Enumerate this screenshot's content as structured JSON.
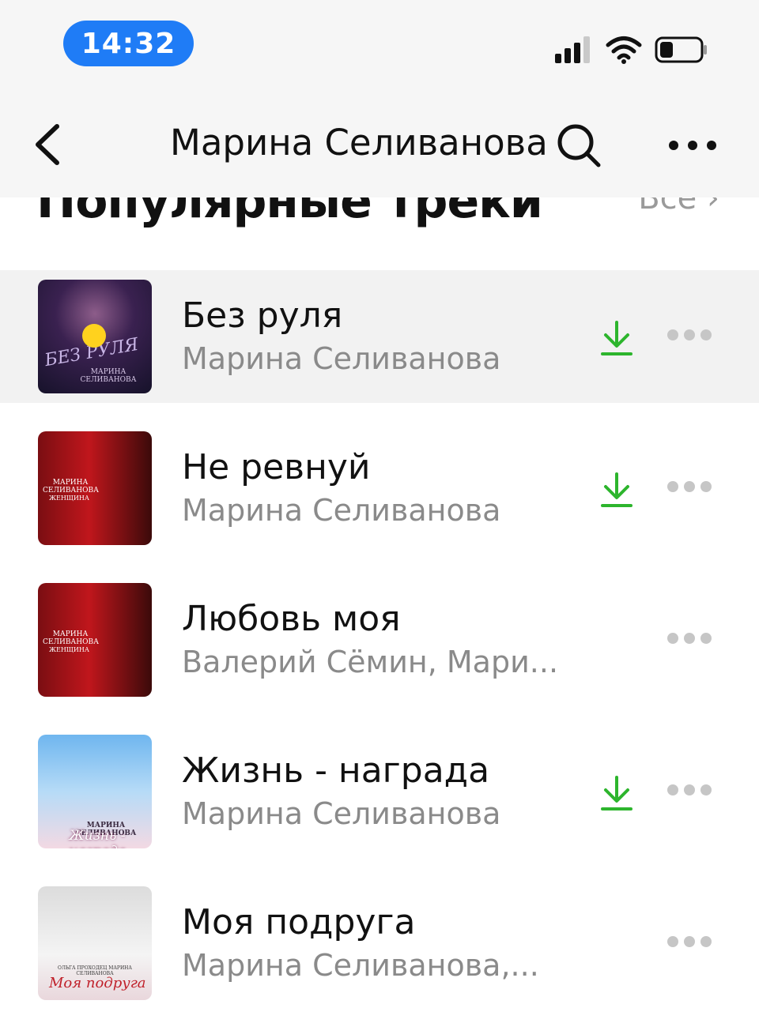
{
  "status_bar": {
    "time": "14:32"
  },
  "nav": {
    "title": "Марина Селиванова"
  },
  "section": {
    "title": "Популярные треки",
    "see_all": "Все"
  },
  "tracks": [
    {
      "title": "Без руля",
      "artist": "Марина Селиванова",
      "downloaded": true,
      "playing": true,
      "cover_text": "БЕЗ РУЛЯ",
      "cover_sub": "МАРИНА СЕЛИВАНОВА"
    },
    {
      "title": "Не ревнуй",
      "artist": "Марина Селиванова",
      "downloaded": true,
      "cover_text": "МАРИНА СЕЛИВАНОВА",
      "cover_sub": "ЖЕНЩИНА"
    },
    {
      "title": "Любовь моя",
      "artist": "Валерий Сёмин, Мари...",
      "downloaded": false,
      "cover_text": "МАРИНА СЕЛИВАНОВА",
      "cover_sub": "ЖЕНЩИНА"
    },
    {
      "title": "Жизнь - награда",
      "artist": "Марина Селиванова",
      "downloaded": true,
      "cover_text": "МАРИНА СЕЛИВАНОВА",
      "cover_sub": "Жизнь - награда"
    },
    {
      "title": "Моя подруга",
      "artist": "Марина Селиванова,...",
      "downloaded": false,
      "cover_text": "ОЛЬГА ПРОХОДЕЦ МАРИНА СЕЛИВАНОВА",
      "cover_sub": "Моя подруга"
    }
  ],
  "colors": {
    "accent_blue": "#1f7cf6",
    "download_green": "#2db52d",
    "playing_dot": "#ffd21e",
    "muted": "#8a8a8a"
  },
  "icons": [
    "back-chevron-icon",
    "search-icon",
    "more-icon",
    "download-icon",
    "signal-icon",
    "wifi-icon",
    "battery-icon"
  ]
}
